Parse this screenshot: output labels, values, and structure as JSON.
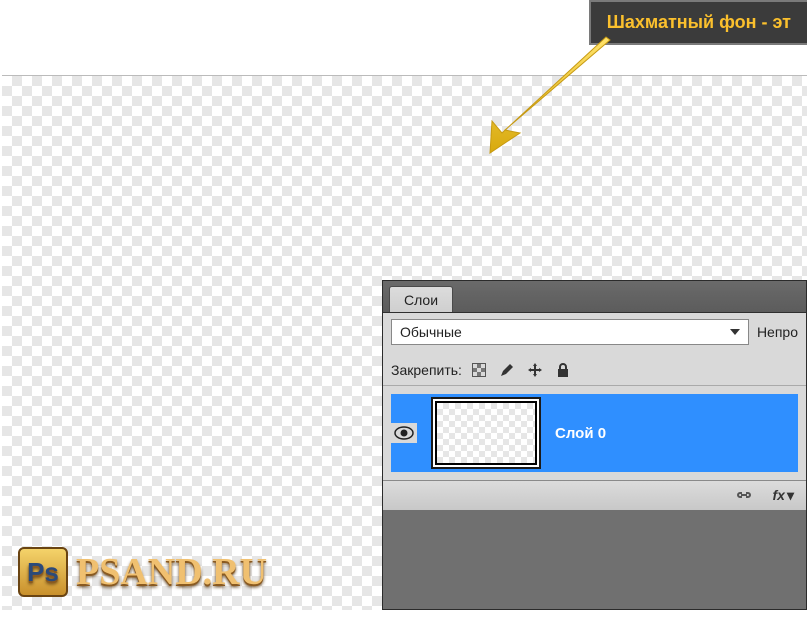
{
  "tooltip": {
    "text": "Шахматный фон - эт"
  },
  "layers_panel": {
    "tab_label": "Слои",
    "blend_mode": "Обычные",
    "opacity_label": "Непро",
    "lock_label": "Закрепить:",
    "layer": {
      "name": "Слой 0"
    },
    "footer": {
      "link_icon": "link-icon",
      "fx_label": "fx"
    }
  },
  "watermark": {
    "badge": "Ps",
    "text": "PSAND.RU"
  }
}
